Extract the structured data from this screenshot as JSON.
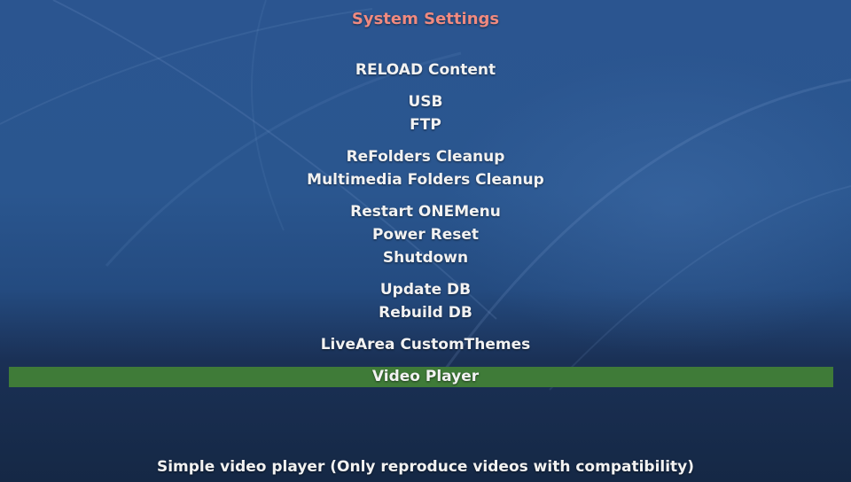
{
  "screen": {
    "title": "System Settings",
    "title_color": "#f08a80",
    "highlight_color": "#3f7b38"
  },
  "menu": {
    "items": [
      {
        "label": "RELOAD Content"
      },
      {
        "label": "USB"
      },
      {
        "label": "FTP"
      },
      {
        "label": "ReFolders Cleanup"
      },
      {
        "label": "Multimedia Folders Cleanup"
      },
      {
        "label": "Restart ONEMenu"
      },
      {
        "label": "Power Reset"
      },
      {
        "label": "Shutdown"
      },
      {
        "label": "Update DB"
      },
      {
        "label": "Rebuild DB"
      },
      {
        "label": "LiveArea CustomThemes"
      },
      {
        "label": "Video Player",
        "selected": true
      }
    ]
  },
  "footer": {
    "description": "Simple video player (Only reproduce videos with compatibility)"
  }
}
